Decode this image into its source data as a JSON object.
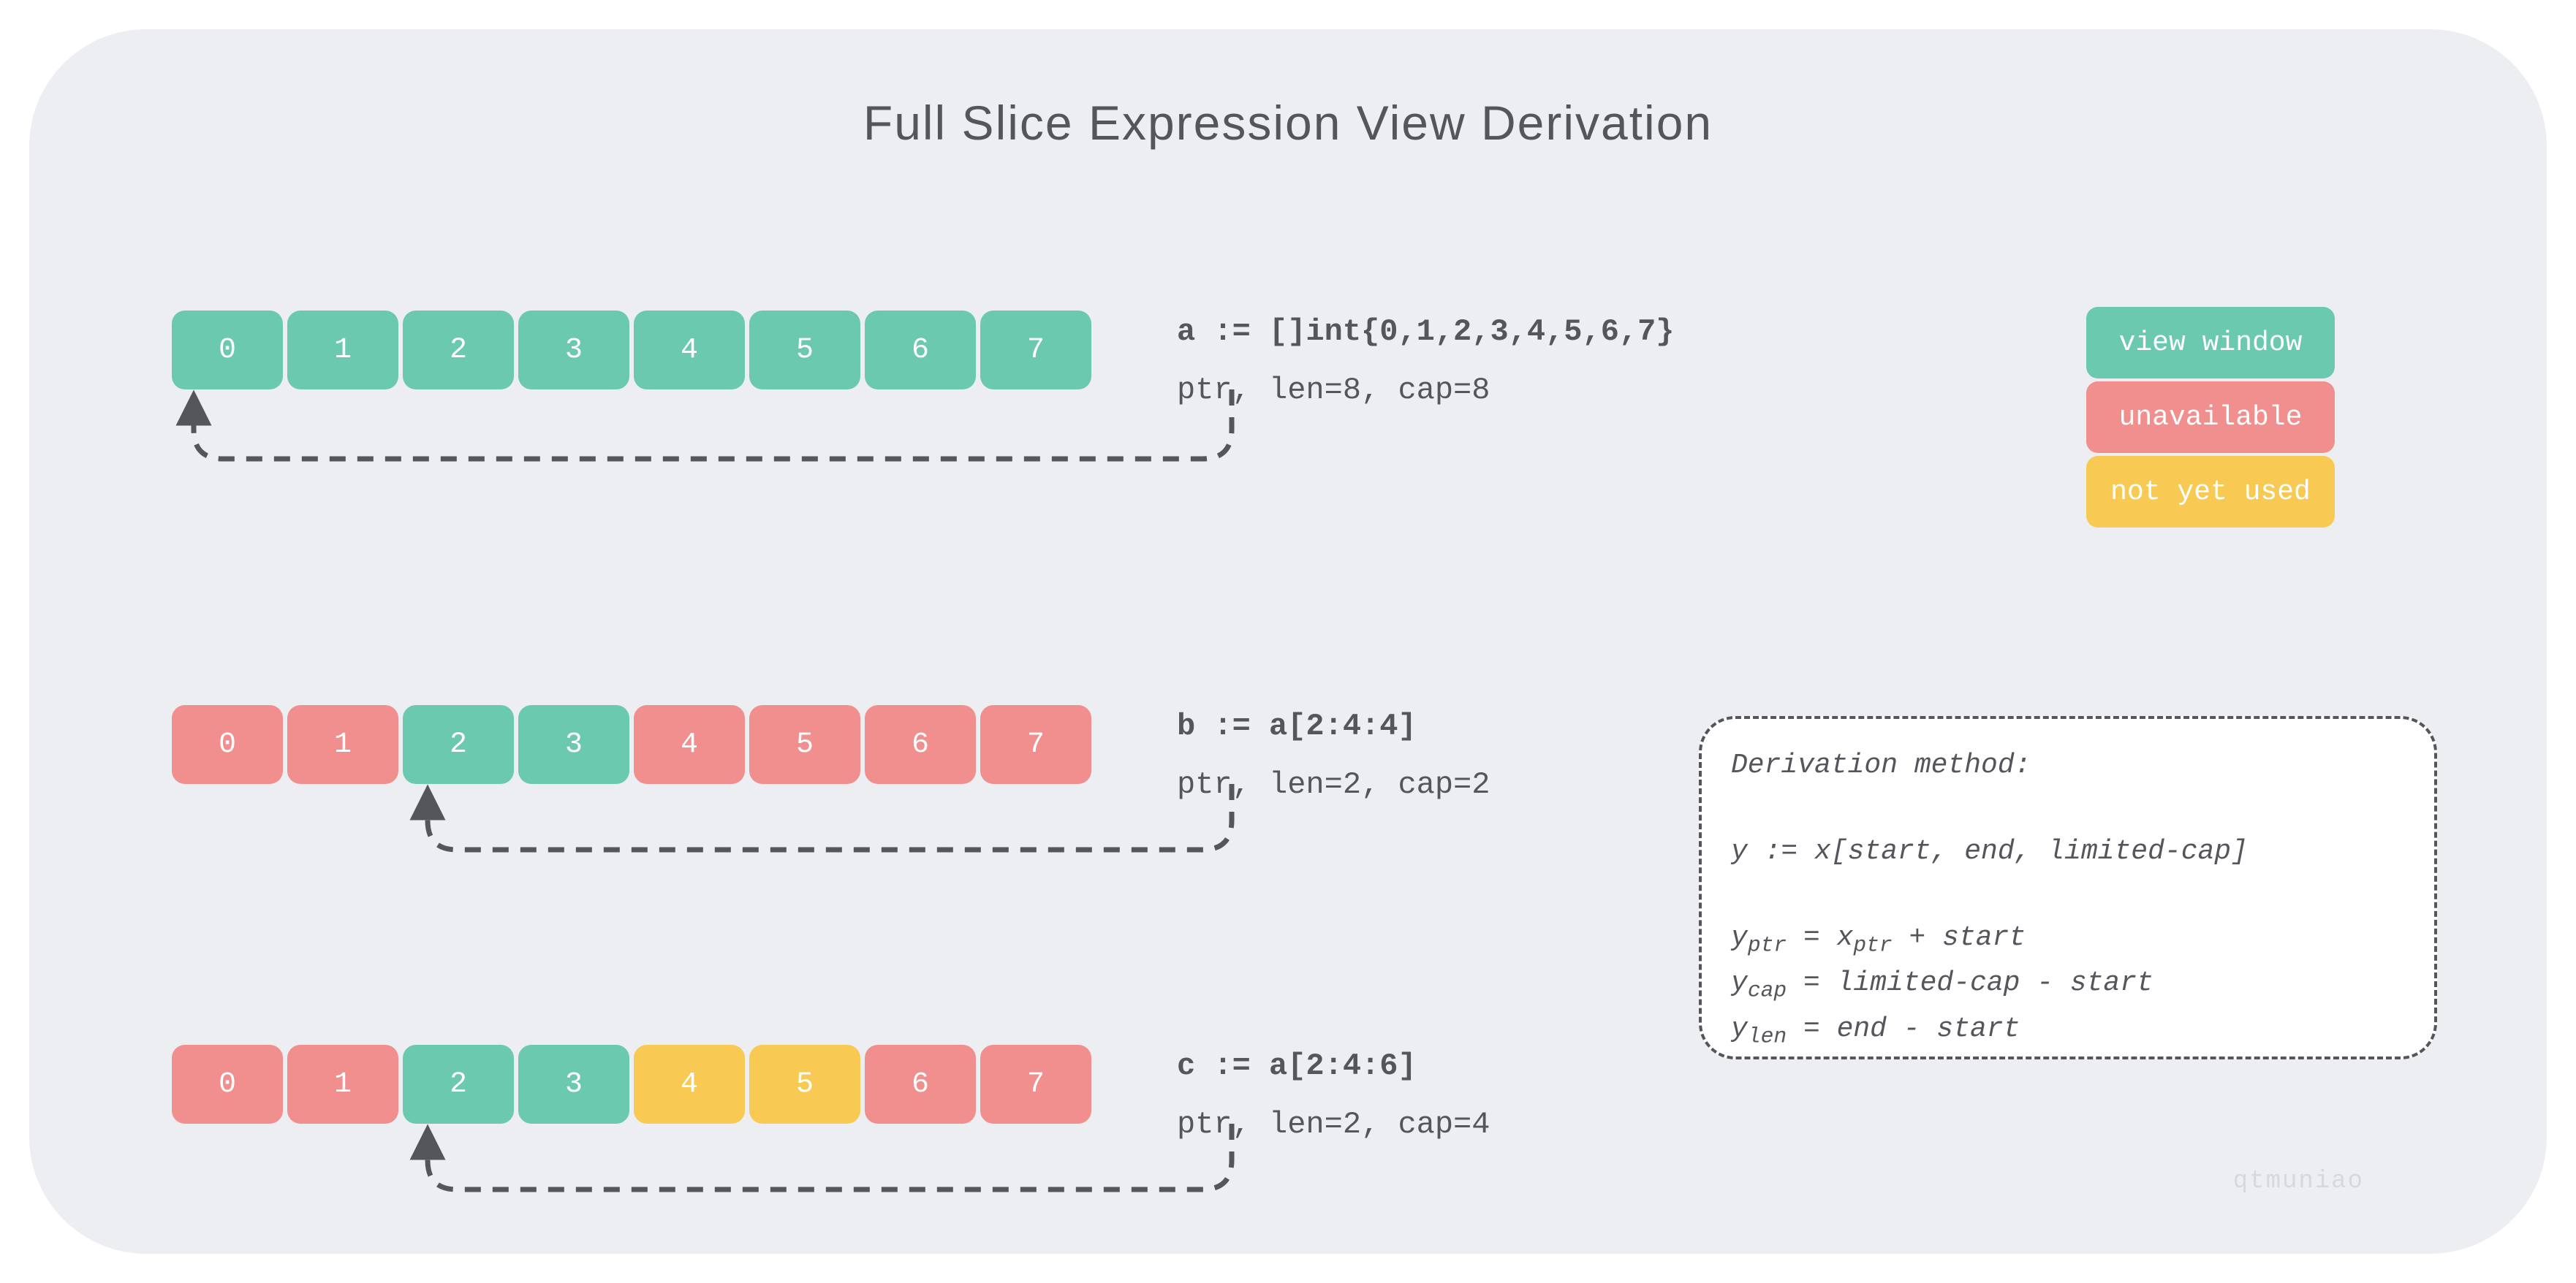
{
  "title": "Full Slice Expression View  Derivation",
  "legend": {
    "view": "view window",
    "unavailable": "unavailable",
    "notyet": "not yet used"
  },
  "rows": {
    "a": {
      "cells": [
        "0",
        "1",
        "2",
        "3",
        "4",
        "5",
        "6",
        "7"
      ],
      "colors": [
        "view",
        "view",
        "view",
        "view",
        "view",
        "view",
        "view",
        "view"
      ],
      "code": "a := []int{0,1,2,3,4,5,6,7}",
      "meta": "ptr, len=8, cap=8",
      "ptr_index": 0
    },
    "b": {
      "cells": [
        "0",
        "1",
        "2",
        "3",
        "4",
        "5",
        "6",
        "7"
      ],
      "colors": [
        "unavail",
        "unavail",
        "view",
        "view",
        "unavail",
        "unavail",
        "unavail",
        "unavail"
      ],
      "code": "b := a[2:4:4]",
      "meta": "ptr, len=2, cap=2",
      "ptr_index": 2
    },
    "c": {
      "cells": [
        "0",
        "1",
        "2",
        "3",
        "4",
        "5",
        "6",
        "7"
      ],
      "colors": [
        "unavail",
        "unavail",
        "view",
        "view",
        "notyet",
        "notyet",
        "unavail",
        "unavail"
      ],
      "code": "c := a[2:4:6]",
      "meta": "ptr, len=2, cap=4",
      "ptr_index": 2
    }
  },
  "derivation": {
    "heading": "Derivation method:",
    "expr": "y := x[start, end, limited-cap]",
    "lines": [
      {
        "lhs_var": "y",
        "lhs_sub": "ptr",
        "rhs": " = x",
        "rhs_sub": "ptr",
        "tail": " + start"
      },
      {
        "lhs_var": "y",
        "lhs_sub": "cap",
        "rhs": " = limited-cap - start",
        "rhs_sub": "",
        "tail": ""
      },
      {
        "lhs_var": "y",
        "lhs_sub": "len",
        "rhs": " = end - start",
        "rhs_sub": "",
        "tail": ""
      }
    ]
  },
  "watermark": "qtmuniao",
  "colors": {
    "view": "#6bc9b0",
    "unavailable": "#f08f8d",
    "notyet": "#f8ca54",
    "text": "#55565c",
    "panel": "#eceef1"
  }
}
